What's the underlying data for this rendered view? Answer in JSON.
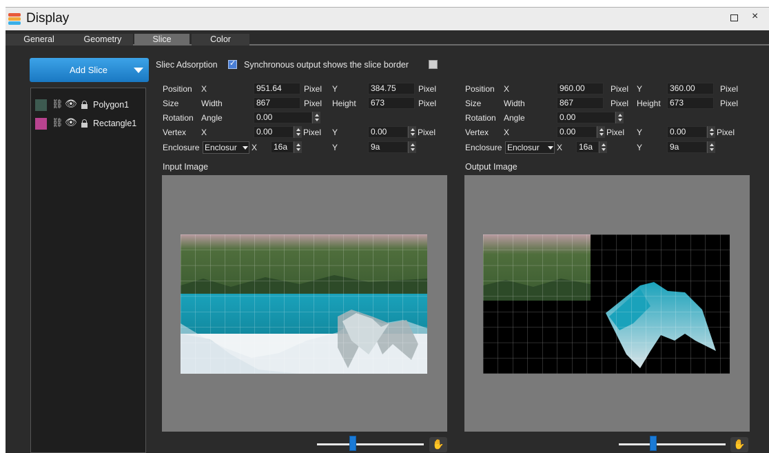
{
  "window": {
    "title": "Display",
    "maximize_icon": "maximize-icon",
    "close_symbol": "×"
  },
  "tabs": [
    {
      "label": "General",
      "active": false
    },
    {
      "label": "Geometry",
      "active": false
    },
    {
      "label": "Slice",
      "active": true
    },
    {
      "label": "Color",
      "active": false
    }
  ],
  "sidebar": {
    "add_slice_label": "Add Slice",
    "items": [
      {
        "name": "Polygon1",
        "color": "#3d5a50",
        "icons": [
          "unlink-icon",
          "eye-icon",
          "lock-icon"
        ]
      },
      {
        "name": "Rectangle1",
        "color": "#b8438f",
        "icons": [
          "unlink-icon",
          "eye-icon",
          "lock-icon"
        ]
      }
    ]
  },
  "options": {
    "adsorption_label": "Sliec Adsorption",
    "adsorption_checked": true,
    "sync_border_label": "Synchronous output shows the slice border",
    "sync_border_checked": false
  },
  "input_props": {
    "position_label": "Position",
    "x_label": "X",
    "y_label": "Y",
    "position_x": "951.64",
    "position_y": "384.75",
    "unit": "Pixel",
    "size_label": "Size",
    "width_label": "Width",
    "height_label": "Height",
    "width": "867",
    "height": "673",
    "rotation_label": "Rotation",
    "angle_label": "Angle",
    "angle": "0.00",
    "vertex_label": "Vertex",
    "vertex_x": "0.00",
    "vertex_y": "0.00",
    "enclosure_label": "Enclosure",
    "enclosure_value": "Enclosur",
    "enclosure_x": "16a",
    "enclosure_y": "9a"
  },
  "output_props": {
    "position_label": "Position",
    "x_label": "X",
    "y_label": "Y",
    "position_x": "960.00",
    "position_y": "360.00",
    "unit": "Pixel",
    "size_label": "Size",
    "width_label": "Width",
    "height_label": "Height",
    "width": "867",
    "height": "673",
    "rotation_label": "Rotation",
    "angle_label": "Angle",
    "angle": "0.00",
    "vertex_label": "Vertex",
    "vertex_x": "0.00",
    "vertex_y": "0.00",
    "enclosure_label": "Enclosure",
    "enclosure_value": "Enclosur",
    "enclosure_x": "16a",
    "enclosure_y": "9a"
  },
  "input_image": {
    "label": "Input Image",
    "zoom_fraction": 0.33
  },
  "output_image": {
    "label": "Output Image",
    "zoom_fraction": 0.33
  },
  "colors": {
    "accent": "#1a7ad6",
    "panel_bg": "#2b2b2b",
    "canvas_bg": "#7a7a7a",
    "water": "#1fa0b8"
  }
}
